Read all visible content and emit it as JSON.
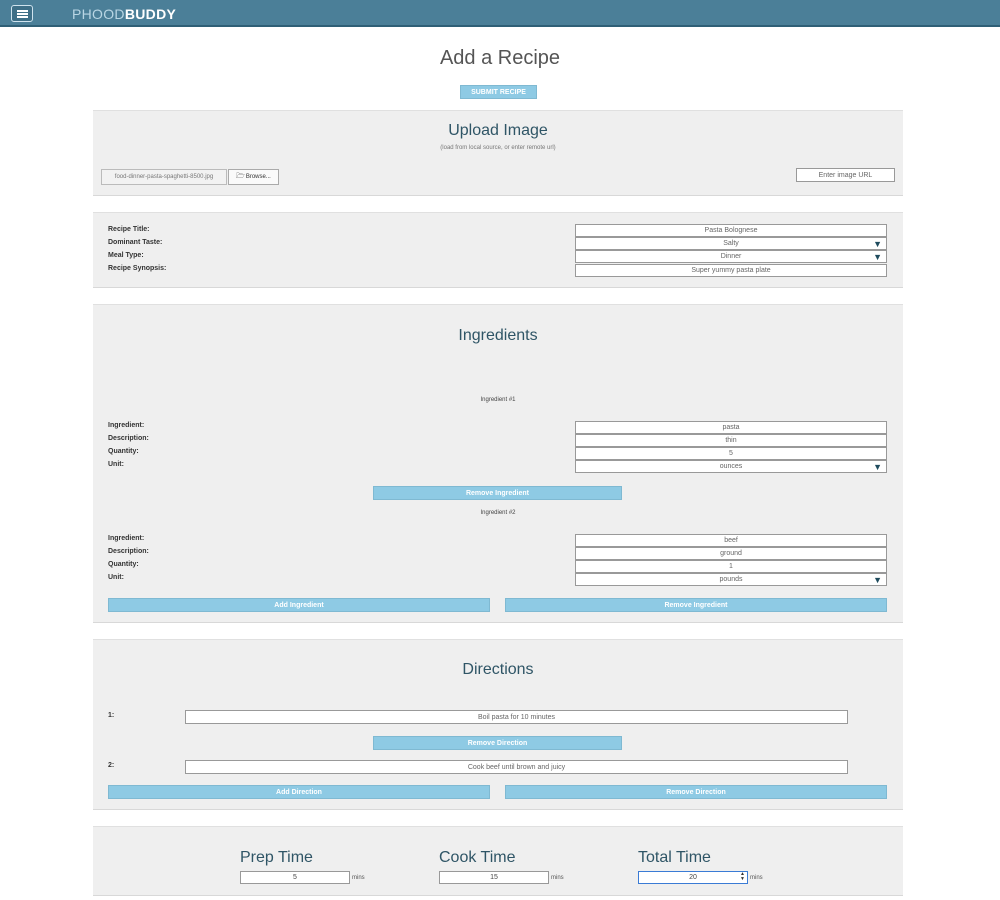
{
  "navbar": {
    "brand_light": "PHOOD",
    "brand_bold": "BUDDY"
  },
  "page": {
    "title": "Add a Recipe",
    "submit_label": "SUBMIT RECIPE"
  },
  "upload": {
    "title": "Upload Image",
    "note": "(load from local source, or enter remote url)",
    "file_name": "food-dinner-pasta-spaghetti-8500.jpg",
    "browse_label": "Browse...",
    "url_placeholder": "Enter image URL"
  },
  "recipe": {
    "labels": {
      "title": "Recipe Title:",
      "taste": "Dominant Taste:",
      "meal": "Meal Type:",
      "synopsis": "Recipe Synopsis:"
    },
    "values": {
      "title": "Pasta Bolognese",
      "taste": "Salty",
      "meal": "Dinner",
      "synopsis": "Super yummy pasta plate"
    }
  },
  "ingredients": {
    "title": "Ingredients",
    "labels": {
      "ingredient": "Ingredient:",
      "description": "Description:",
      "quantity": "Quantity:",
      "unit": "Unit:"
    },
    "items": [
      {
        "heading": "Ingredient #1",
        "ingredient": "pasta",
        "description": "thin",
        "quantity": "5",
        "unit": "ounces"
      },
      {
        "heading": "Ingredient #2",
        "ingredient": "beef",
        "description": "ground",
        "quantity": "1",
        "unit": "pounds"
      }
    ],
    "remove_label": "Remove Ingredient",
    "add_label": "Add Ingredient"
  },
  "directions": {
    "title": "Directions",
    "items": [
      {
        "number": "1:",
        "text": "Boil pasta for 10 minutes"
      },
      {
        "number": "2:",
        "text": "Cook beef until brown and juicy"
      }
    ],
    "remove_label": "Remove Direction",
    "add_label": "Add Direction"
  },
  "times": {
    "prep_label": "Prep Time",
    "cook_label": "Cook Time",
    "total_label": "Total Time",
    "prep_value": "5",
    "cook_value": "15",
    "total_value": "20",
    "unit": "mins"
  }
}
